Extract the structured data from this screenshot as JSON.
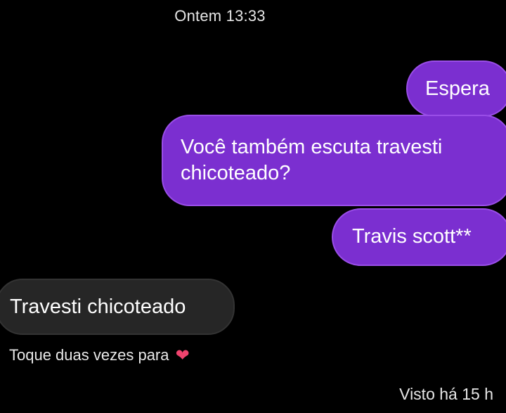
{
  "conversation": {
    "timestamp": "Ontem 13:33",
    "messages": [
      {
        "direction": "outgoing",
        "text": "Espera"
      },
      {
        "direction": "outgoing",
        "lines": [
          "Você também escuta travesti",
          "chicoteado?"
        ]
      },
      {
        "direction": "outgoing",
        "text": "Travis scott**"
      },
      {
        "direction": "incoming",
        "text": "Travesti chicoteado"
      }
    ],
    "reaction_hint": "Toque duas vezes para",
    "reaction_icon": "heart-icon",
    "seen_status": "Visto há 15 h"
  },
  "colors": {
    "background": "#000000",
    "outgoing_bubble": "#7b2fd0",
    "incoming_bubble": "#262626",
    "heart": "#f0436e"
  }
}
